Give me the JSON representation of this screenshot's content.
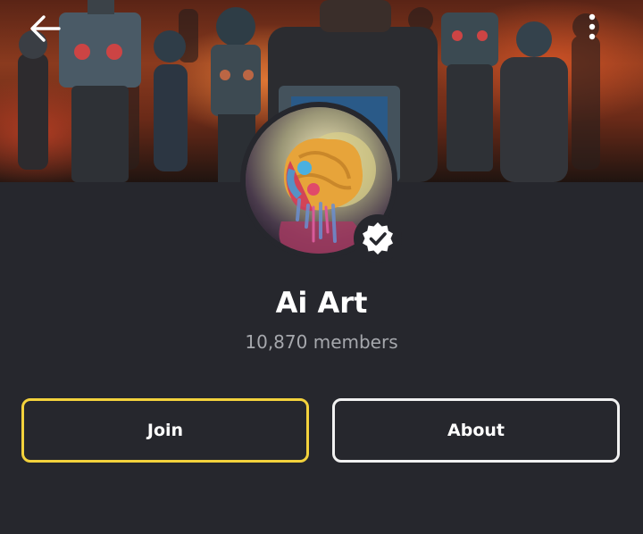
{
  "header": {
    "back_icon": "arrow-left-icon",
    "menu_icon": "more-vertical-icon"
  },
  "group": {
    "name": "Ai Art",
    "members": "10,870 members",
    "verified_icon": "verified-badge-icon"
  },
  "actions": {
    "join_label": "Join",
    "about_label": "About"
  },
  "colors": {
    "background": "#26272d",
    "join_border": "#f3d23c",
    "about_border": "#f1f1f1",
    "muted_text": "#a6a8ad"
  }
}
